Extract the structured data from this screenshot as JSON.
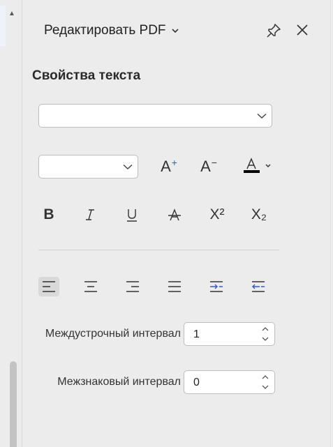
{
  "panel": {
    "title": "Редактировать PDF",
    "section_title": "Свойства текста"
  },
  "font": {
    "family_value": "",
    "size_value": ""
  },
  "format_buttons": {
    "bold": "B",
    "italic": "I",
    "underline": "U",
    "strike": "A",
    "superscript": "X²",
    "subscript": "X₂",
    "grow": "A",
    "shrink": "A",
    "grow_mark": "+",
    "shrink_mark": "−"
  },
  "alignment": {
    "active": "left"
  },
  "line_spacing": {
    "label": "Междустрочный интервал",
    "value": "1"
  },
  "char_spacing": {
    "label": "Межзнаковый интервал",
    "value": "0"
  },
  "colors": {
    "accent": "#2a5bd7",
    "text_color": "#000000",
    "background": "#ececec"
  }
}
